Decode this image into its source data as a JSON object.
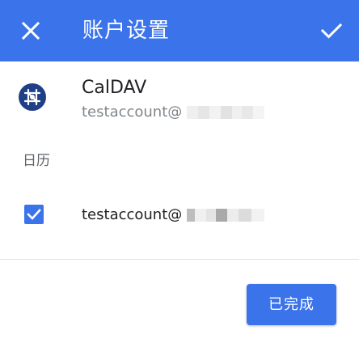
{
  "appbar": {
    "title": "账户设置",
    "close_icon": "close-icon",
    "confirm_icon": "check-icon",
    "color": "#3b73ea"
  },
  "account": {
    "name": "CalDAV",
    "email": "testaccount@",
    "logo_icon": "caldav-logo-icon"
  },
  "section": {
    "header": "日历"
  },
  "calendars": [
    {
      "name": "testaccount@",
      "checked": true
    }
  ],
  "actions": {
    "done_label": "已完成"
  }
}
